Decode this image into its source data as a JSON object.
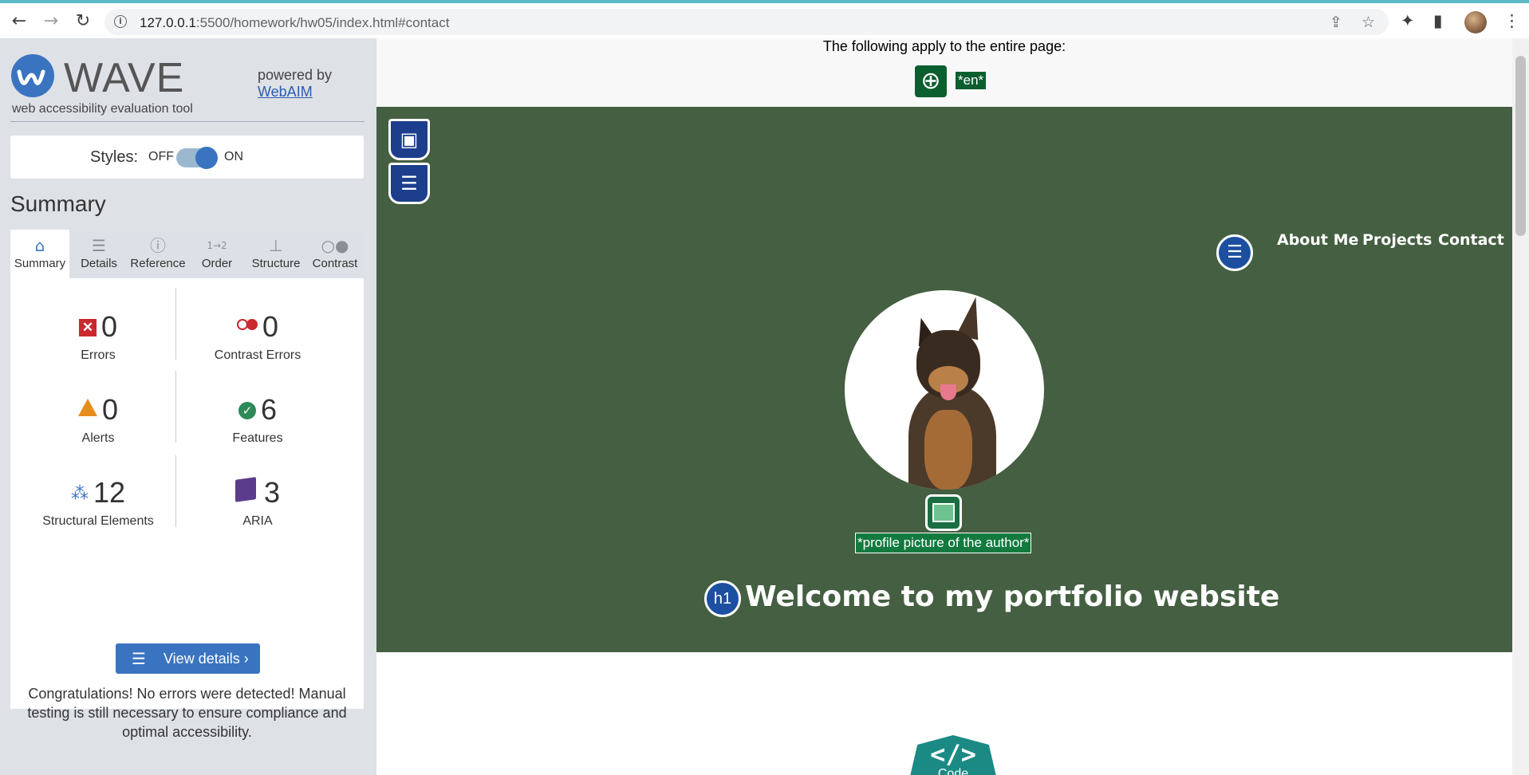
{
  "browser": {
    "url_host": "127.0.0.1",
    "url_path": ":5500/homework/hw05/index.html#contact",
    "icons": [
      "back-arrow-icon",
      "forward-arrow-icon",
      "reload-icon",
      "site-info-icon",
      "share-icon",
      "star-icon",
      "extensions-icon",
      "side-panel-icon",
      "profile-avatar",
      "menu-dots-icon"
    ]
  },
  "wave": {
    "logo_text": "WAVE",
    "tagline": "web accessibility evaluation tool",
    "powered_by": "powered by",
    "powered_link": "WebAIM",
    "styles_label": "Styles:",
    "styles_off": "OFF",
    "styles_on": "ON",
    "styles_state": "on",
    "summary_heading": "Summary",
    "tabs": [
      {
        "label": "Summary",
        "icon": "home-icon",
        "active": true
      },
      {
        "label": "Details",
        "icon": "list-icon",
        "active": false
      },
      {
        "label": "Reference",
        "icon": "info-icon",
        "active": false
      },
      {
        "label": "Order",
        "icon": "order-icon",
        "active": false
      },
      {
        "label": "Structure",
        "icon": "hierarchy-icon",
        "active": false
      },
      {
        "label": "Contrast",
        "icon": "contrast-icon",
        "active": false
      }
    ],
    "stats": {
      "errors": {
        "value": "0",
        "label": "Errors"
      },
      "contrast_errors": {
        "value": "0",
        "label": "Contrast Errors"
      },
      "alerts": {
        "value": "0",
        "label": "Alerts"
      },
      "features": {
        "value": "6",
        "label": "Features"
      },
      "structural": {
        "value": "12",
        "label": "Structural Elements"
      },
      "aria": {
        "value": "3",
        "label": "ARIA"
      }
    },
    "view_details": "View details ›",
    "congrats": "Congratulations! No errors were detected! Manual testing is still necessary to ensure compliance and optimal accessibility.",
    "colors": {
      "accent": "#3a74c0",
      "error": "#c8282e",
      "alert": "#e58d1a",
      "feature": "#2e8a57",
      "aria": "#5b3c8c"
    }
  },
  "page": {
    "apply_text": "The following apply to the entire page:",
    "lang_label": "*en*",
    "nav_links": [
      "About Me",
      "Projects",
      "Contact"
    ],
    "img_alt": "*profile picture of the author*",
    "h1_badge": "h1",
    "hero_title": "Welcome to my portfolio website",
    "code_glyph": "</>",
    "code_label": "Code",
    "colors": {
      "hero_bg": "#445f41"
    }
  }
}
